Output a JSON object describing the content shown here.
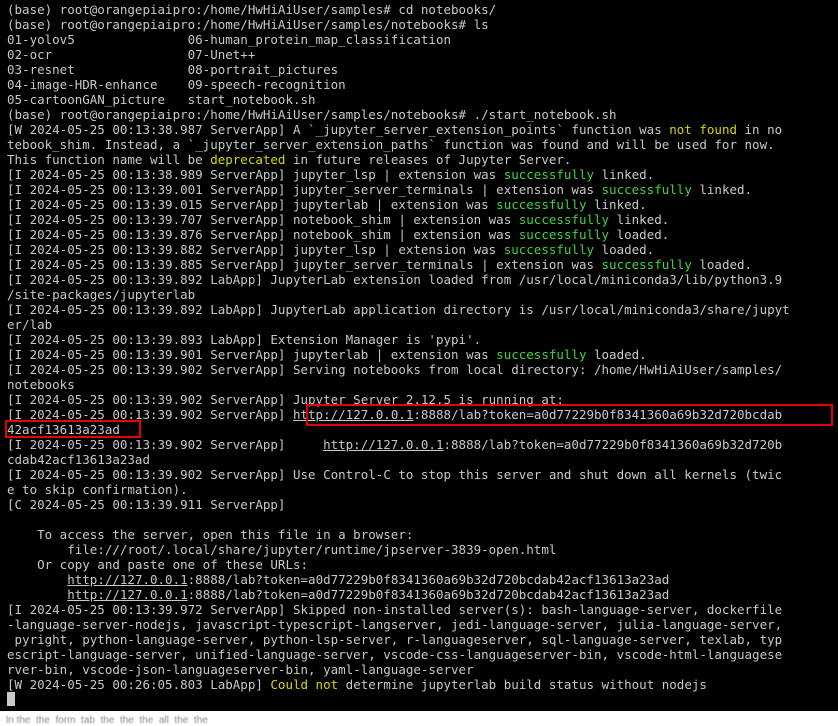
{
  "terminal": {
    "lines": [
      [
        {
          "t": "(base) root@orangepiaipro:/home/HwHiAiUser/samples# cd notebooks/"
        }
      ],
      [
        {
          "t": "(base) root@orangepiaipro:/home/HwHiAiUser/samples/notebooks# ls"
        }
      ],
      [
        {
          "t": "01-yolov5               06-human_protein_map_classification"
        }
      ],
      [
        {
          "t": "02-ocr                  07-Unet++"
        }
      ],
      [
        {
          "t": "03-resnet               08-portrait_pictures"
        }
      ],
      [
        {
          "t": "04-image-HDR-enhance    09-speech-recognition"
        }
      ],
      [
        {
          "t": "05-cartoonGAN_picture   start_notebook.sh"
        }
      ],
      [
        {
          "t": "(base) root@orangepiaipro:/home/HwHiAiUser/samples/notebooks# ./start_notebook.sh"
        }
      ],
      [
        {
          "t": "[W 2024-05-25 00:13:38.987 ServerApp] A `_jupyter_server_extension_points` function was "
        },
        {
          "t": "not found",
          "c": "y"
        },
        {
          "t": " in no"
        }
      ],
      [
        {
          "t": "tebook_shim. Instead, a `_jupyter_server_extension_paths` function was found and will be used for now."
        }
      ],
      [
        {
          "t": "This function name will be "
        },
        {
          "t": "deprecated",
          "c": "y"
        },
        {
          "t": " in future releases of Jupyter Server."
        }
      ],
      [
        {
          "t": "[I 2024-05-25 00:13:38.989 ServerApp] jupyter_lsp | extension was "
        },
        {
          "t": "successfully",
          "c": "g"
        },
        {
          "t": " linked."
        }
      ],
      [
        {
          "t": "[I 2024-05-25 00:13:39.001 ServerApp] jupyter_server_terminals | extension was "
        },
        {
          "t": "successfully",
          "c": "g"
        },
        {
          "t": " linked."
        }
      ],
      [
        {
          "t": "[I 2024-05-25 00:13:39.015 ServerApp] jupyterlab | extension was "
        },
        {
          "t": "successfully",
          "c": "g"
        },
        {
          "t": " linked."
        }
      ],
      [
        {
          "t": "[I 2024-05-25 00:13:39.707 ServerApp] notebook_shim | extension was "
        },
        {
          "t": "successfully",
          "c": "g"
        },
        {
          "t": " linked."
        }
      ],
      [
        {
          "t": "[I 2024-05-25 00:13:39.876 ServerApp] notebook_shim | extension was "
        },
        {
          "t": "successfully",
          "c": "g"
        },
        {
          "t": " loaded."
        }
      ],
      [
        {
          "t": "[I 2024-05-25 00:13:39.882 ServerApp] jupyter_lsp | extension was "
        },
        {
          "t": "successfully",
          "c": "g"
        },
        {
          "t": " loaded."
        }
      ],
      [
        {
          "t": "[I 2024-05-25 00:13:39.885 ServerApp] jupyter_server_terminals | extension was "
        },
        {
          "t": "successfully",
          "c": "g"
        },
        {
          "t": " loaded."
        }
      ],
      [
        {
          "t": "[I 2024-05-25 00:13:39.892 LabApp] JupyterLab extension loaded from /usr/local/miniconda3/lib/python3.9"
        }
      ],
      [
        {
          "t": "/site-packages/jupyterlab"
        }
      ],
      [
        {
          "t": "[I 2024-05-25 00:13:39.892 LabApp] JupyterLab application directory is /usr/local/miniconda3/share/jupyt"
        }
      ],
      [
        {
          "t": "er/lab"
        }
      ],
      [
        {
          "t": "[I 2024-05-25 00:13:39.893 LabApp] Extension Manager is 'pypi'."
        }
      ],
      [
        {
          "t": "[I 2024-05-25 00:13:39.901 ServerApp] jupyterlab | extension was "
        },
        {
          "t": "successfully",
          "c": "g"
        },
        {
          "t": " loaded."
        }
      ],
      [
        {
          "t": "[I 2024-05-25 00:13:39.902 ServerApp] Serving notebooks from local directory: /home/HwHiAiUser/samples/"
        }
      ],
      [
        {
          "t": "notebooks"
        }
      ],
      [
        {
          "t": "[I 2024-05-25 00:13:39.902 ServerApp] Jupyter Server 2.12.5 is running at:"
        }
      ],
      [
        {
          "t": "[I 2024-05-25 00:13:39.902 ServerApp] "
        },
        {
          "t": "http://127.0.0.1",
          "c": "u"
        },
        {
          "t": ":8888/lab?token=a0d77229b0f8341360a69b32d720bcdab"
        }
      ],
      [
        {
          "t": "42acf13613a23ad"
        }
      ],
      [
        {
          "t": "[I 2024-05-25 00:13:39.902 ServerApp]     "
        },
        {
          "t": "http://127.0.0.1",
          "c": "u"
        },
        {
          "t": ":8888/lab?token=a0d77229b0f8341360a69b32d720b"
        }
      ],
      [
        {
          "t": "cdab42acf13613a23ad"
        }
      ],
      [
        {
          "t": "[I 2024-05-25 00:13:39.902 ServerApp] Use Control-C to stop this server and shut down all kernels (twic"
        }
      ],
      [
        {
          "t": "e to skip confirmation)."
        }
      ],
      [
        {
          "t": "[C 2024-05-25 00:13:39.911 ServerApp]"
        }
      ],
      [
        {
          "t": ""
        }
      ],
      [
        {
          "t": "    To access the server, open this file in a browser:"
        }
      ],
      [
        {
          "t": "        file:///root/.local/share/jupyter/runtime/jpserver-3839-open.html"
        }
      ],
      [
        {
          "t": "    Or copy and paste one of these URLs:"
        }
      ],
      [
        {
          "t": "        "
        },
        {
          "t": "http://127.0.0.1",
          "c": "u"
        },
        {
          "t": ":8888/lab?token=a0d77229b0f8341360a69b32d720bcdab42acf13613a23ad"
        }
      ],
      [
        {
          "t": "        "
        },
        {
          "t": "http://127.0.0.1",
          "c": "u"
        },
        {
          "t": ":8888/lab?token=a0d77229b0f8341360a69b32d720bcdab42acf13613a23ad"
        }
      ],
      [
        {
          "t": "[I 2024-05-25 00:13:39.972 ServerApp] Skipped non-installed server(s): bash-language-server, dockerfile"
        }
      ],
      [
        {
          "t": "-language-server-nodejs, javascript-typescript-langserver, jedi-language-server, julia-language-server,"
        }
      ],
      [
        {
          "t": " pyright, python-language-server, python-lsp-server, r-languageserver, sql-language-server, texlab, typ"
        }
      ],
      [
        {
          "t": "escript-language-server, unified-language-server, vscode-css-languageserver-bin, vscode-html-languagese"
        }
      ],
      [
        {
          "t": "rver-bin, vscode-json-languageserver-bin, yaml-language-server"
        }
      ],
      [
        {
          "t": "[W 2024-05-25 00:26:05.803 LabApp] "
        },
        {
          "t": "Could not",
          "c": "y"
        },
        {
          "t": " determine jupyterlab build status without nodejs"
        }
      ]
    ]
  },
  "colors": {
    "background": "#000000",
    "text": "#c8c8c8",
    "warning_yellow": "#d7d700",
    "success_green": "#3fd43f",
    "highlight_red": "#e60000"
  }
}
